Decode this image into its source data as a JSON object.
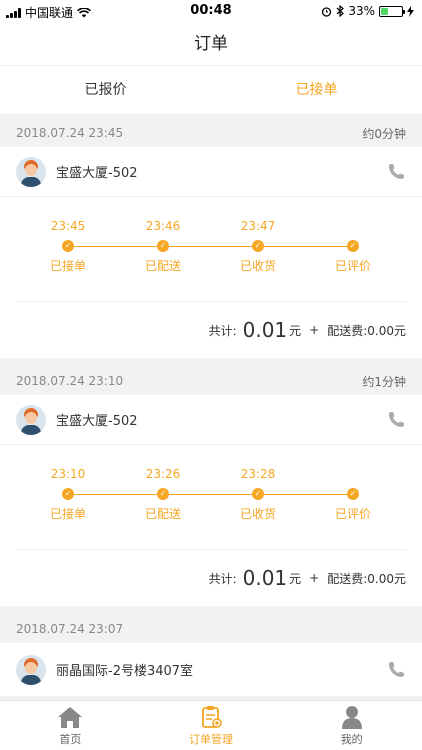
{
  "status_bar": {
    "carrier": "中国联通",
    "time": "00:48",
    "battery": "33%"
  },
  "nav": {
    "title": "订单"
  },
  "tabs": [
    {
      "label": "已报价"
    },
    {
      "label": "已接单"
    }
  ],
  "orders": [
    {
      "datetime": "2018.07.24 23:45",
      "eta": "约0分钟",
      "address": "宝盛大厦-502",
      "steps": [
        {
          "time": "23:45",
          "label": "已接单"
        },
        {
          "time": "23:46",
          "label": "已配送"
        },
        {
          "time": "23:47",
          "label": "已收货"
        },
        {
          "time": "",
          "label": "已评价"
        }
      ],
      "total_label": "共计:",
      "total": "0.01",
      "unit": "元",
      "plus": "+",
      "delivery_label": "配送费:",
      "delivery_fee": "0.00元"
    },
    {
      "datetime": "2018.07.24 23:10",
      "eta": "约1分钟",
      "address": "宝盛大厦-502",
      "steps": [
        {
          "time": "23:10",
          "label": "已接单"
        },
        {
          "time": "23:26",
          "label": "已配送"
        },
        {
          "time": "23:28",
          "label": "已收货"
        },
        {
          "time": "",
          "label": "已评价"
        }
      ],
      "total_label": "共计:",
      "total": "0.01",
      "unit": "元",
      "plus": "+",
      "delivery_label": "配送费:",
      "delivery_fee": "0.00元"
    },
    {
      "datetime": "2018.07.24 23:07",
      "eta": "",
      "address": "丽晶国际-2号楼3407室"
    }
  ],
  "tabbar": [
    {
      "label": "首页",
      "icon": "home-icon"
    },
    {
      "label": "订单管理",
      "icon": "order-icon"
    },
    {
      "label": "我的",
      "icon": "user-icon"
    }
  ],
  "colors": {
    "accent": "#f5a623",
    "battery": "#4cd964"
  }
}
